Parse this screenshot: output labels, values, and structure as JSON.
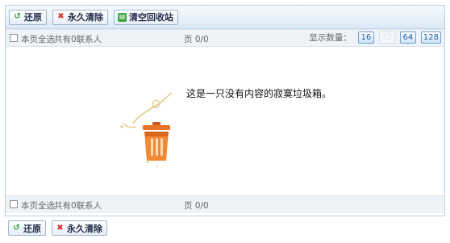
{
  "toolbar": {
    "restore_label": "还原",
    "delete_label": "永久清除",
    "empty_label": "清空回收站"
  },
  "selection_bar": {
    "select_all": "本页全选",
    "contact_count": "共有0联系人",
    "page": "页 0/0",
    "size_label": "显示数量：",
    "sizes": [
      "16",
      "32",
      "64",
      "128"
    ],
    "active_size": "32"
  },
  "content": {
    "empty_message": "这是一只没有内容的寂寞垃圾箱。"
  },
  "colors": {
    "toolbar_gradient_top": "#f7fbff",
    "toolbar_gradient_bottom": "#dbe9f6",
    "border": "#b9cfe4",
    "bin_orange": "#e8742a",
    "size_button_text": "#1f5f9e"
  },
  "icons": {
    "restore": "restore-arrow-icon",
    "delete": "red-x-icon",
    "empty": "green-bin-icon",
    "illustration": "orange-trash-bin-icon"
  }
}
